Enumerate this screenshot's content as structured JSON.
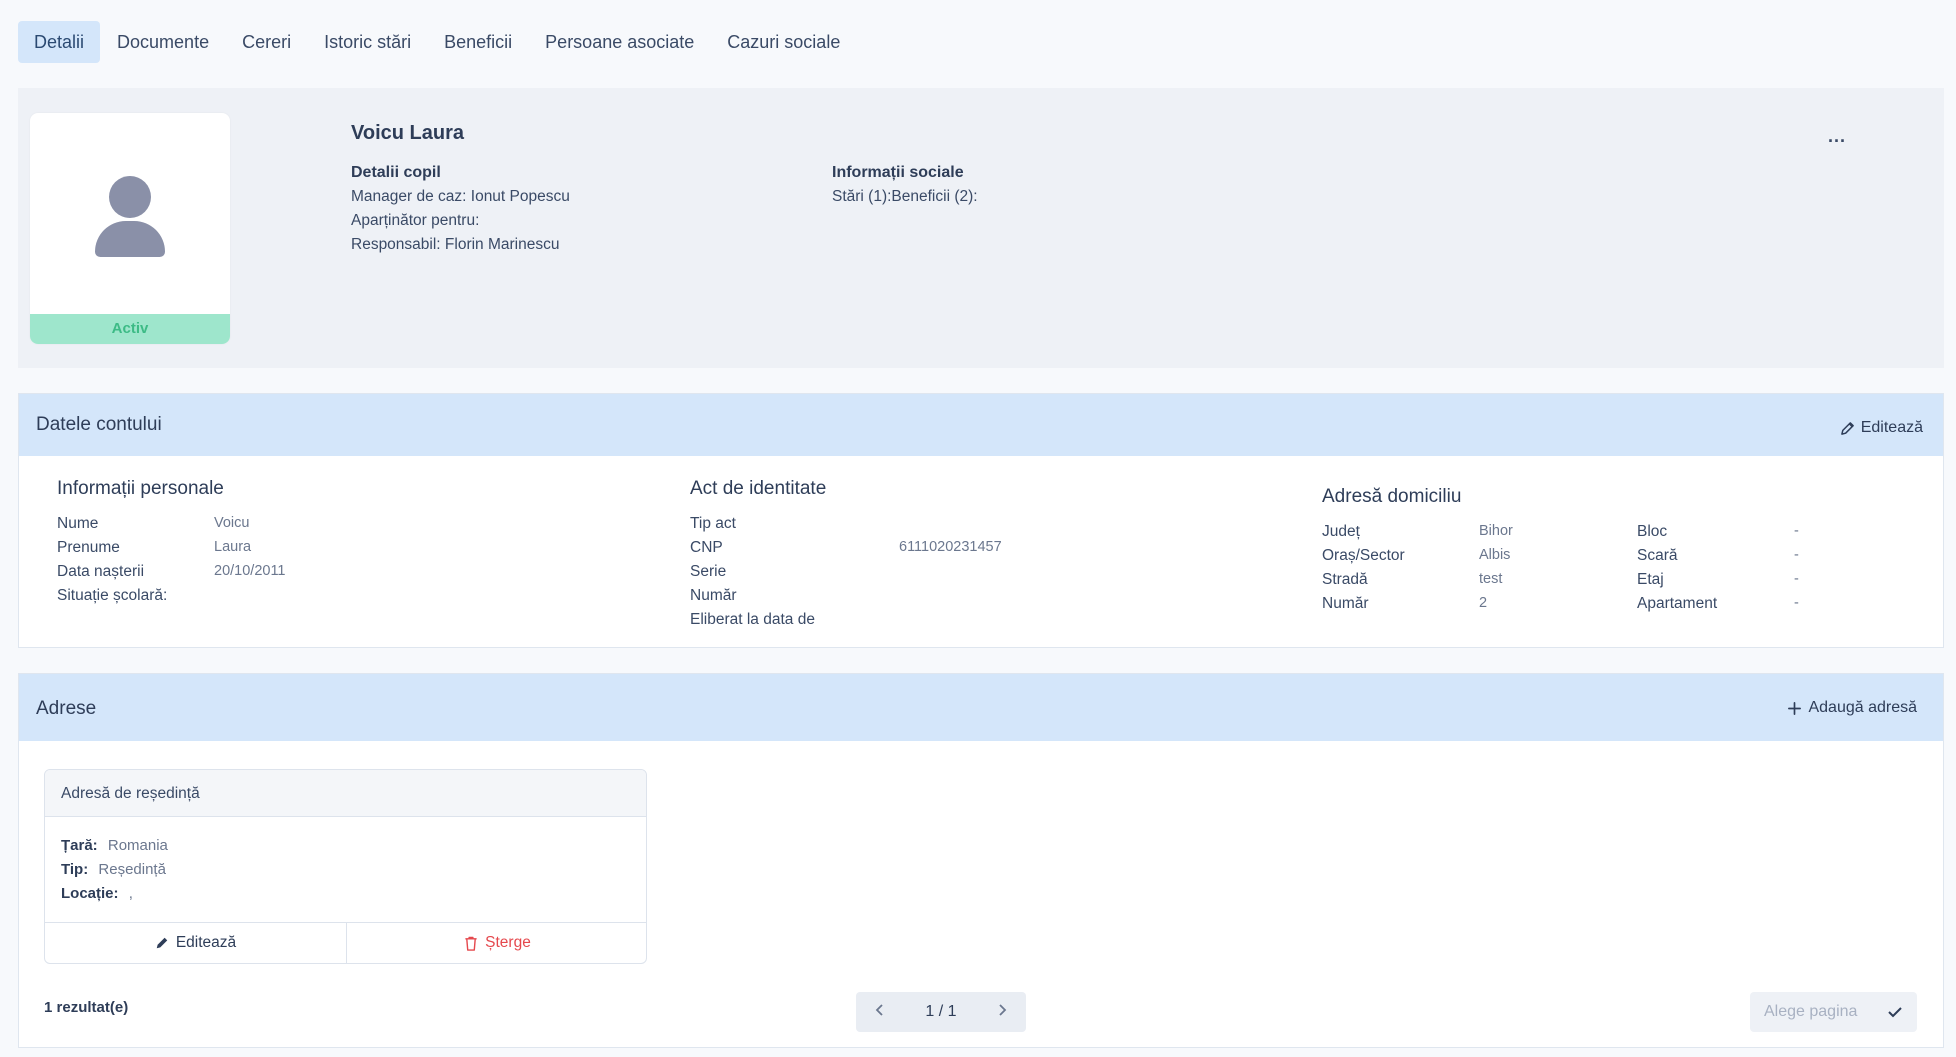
{
  "tabs": [
    {
      "label": "Detalii",
      "active": true
    },
    {
      "label": "Documente"
    },
    {
      "label": "Cereri"
    },
    {
      "label": "Istoric stări"
    },
    {
      "label": "Beneficii"
    },
    {
      "label": "Persoane asociate"
    },
    {
      "label": "Cazuri sociale"
    }
  ],
  "profile": {
    "name": "Voicu Laura",
    "status": "Activ",
    "more": "...",
    "child_details": {
      "title": "Detalii copil",
      "manager": "Manager de caz: Ionut Popescu",
      "belongs": "Aparținător pentru:",
      "responsible": "Responsabil: Florin Marinescu"
    },
    "social_info": {
      "title": "Informații sociale",
      "summary": "Stări (1):Beneficii (2):"
    }
  },
  "account": {
    "title": "Datele contului",
    "edit_label": "Editează",
    "personal": {
      "title": "Informații personale",
      "rows": [
        {
          "label": "Nume",
          "value": "Voicu"
        },
        {
          "label": "Prenume",
          "value": "Laura"
        },
        {
          "label": "Data nașterii",
          "value": "20/10/2011"
        },
        {
          "label": "Situație școlară:",
          "value": ""
        }
      ]
    },
    "identity": {
      "title": "Act de identitate",
      "rows": [
        {
          "label": "Tip act",
          "value": ""
        },
        {
          "label": "CNP",
          "value": "6111020231457"
        },
        {
          "label": "Serie",
          "value": ""
        },
        {
          "label": "Număr",
          "value": ""
        },
        {
          "label": "Eliberat la data de",
          "value": ""
        }
      ]
    },
    "domicile": {
      "title": "Adresă domiciliu",
      "rows": [
        {
          "label": "Județ",
          "value": "Bihor",
          "label2": "Bloc",
          "value2": "-"
        },
        {
          "label": "Oraș/Sector",
          "value": "Albis",
          "label2": "Scară",
          "value2": "-"
        },
        {
          "label": "Stradă",
          "value": "test",
          "label2": "Etaj",
          "value2": "-"
        },
        {
          "label": "Număr",
          "value": "2",
          "label2": "Apartament",
          "value2": "-"
        }
      ]
    }
  },
  "addresses": {
    "title": "Adrese",
    "add_label": "Adaugă adresă",
    "card": {
      "title": "Adresă de reședință",
      "country_label": "Țară:",
      "country": "Romania",
      "type_label": "Tip:",
      "type": "Reședință",
      "location_label": "Locație:",
      "location": ",",
      "edit_label": "Editează",
      "delete_label": "Șterge"
    },
    "results": "1 rezultat(e)",
    "page": "1 / 1",
    "page_select_placeholder": "Alege pagina"
  },
  "colors": {
    "accent_light": "#d4e6fa",
    "status_green": "#3dbb86",
    "danger": "#e5484d"
  }
}
